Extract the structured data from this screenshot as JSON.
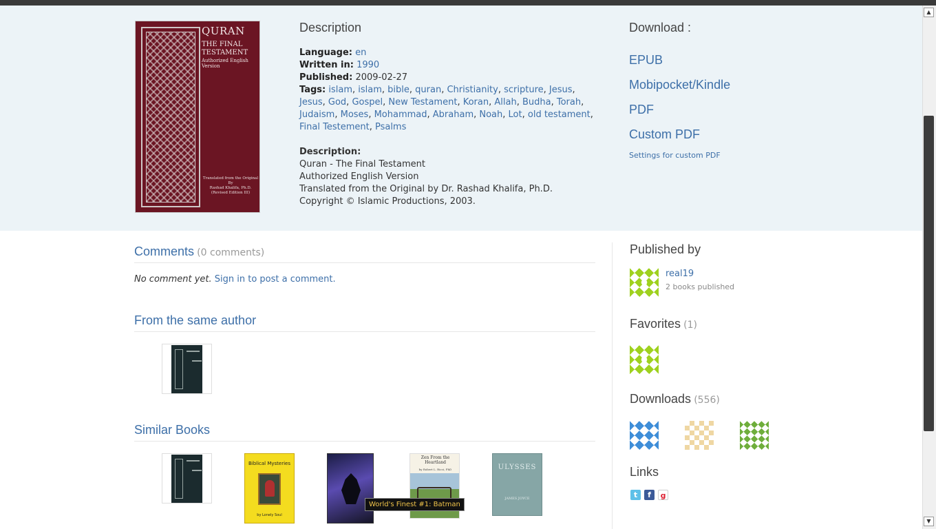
{
  "book": {
    "cover": {
      "title": "QURAN",
      "subtitle": "THE FINAL TESTAMENT",
      "edition": "Authorized English Version",
      "footer_line1": "Translated from the Original",
      "footer_line2": "By",
      "footer_line3": "Rashad Khalifa, Ph.D.",
      "footer_line4": "(Revised Edition III)"
    },
    "description_heading": "Description",
    "language_label": "Language:",
    "language_value": "en",
    "written_label": "Written in:",
    "written_value": "1990",
    "published_label": "Published:",
    "published_value": "2009-02-27",
    "tags_label": "Tags:",
    "tags": [
      "islam",
      "islam",
      "bible",
      "quran",
      "Christianity",
      "scripture",
      "Jesus",
      "Jesus",
      "God",
      "Gospel",
      "New Testament",
      "Koran",
      "Allah",
      "Budha",
      "Torah",
      "Judaism",
      "Moses",
      "Mohammad",
      "Abraham",
      "Noah",
      "Lot",
      "old testament",
      "Final Testement",
      "Psalms"
    ],
    "desc_label": "Description:",
    "desc_lines": [
      "Quran - The Final Testament",
      "Authorized English Version",
      "Translated from the Original by Dr. Rashad Khalifa, Ph.D.",
      "Copyright © Islamic Productions, 2003."
    ]
  },
  "download": {
    "heading": "Download :",
    "links": [
      "EPUB",
      "Mobipocket/Kindle",
      "PDF",
      "Custom PDF"
    ],
    "settings_link": "Settings for custom PDF"
  },
  "comments": {
    "title": "Comments",
    "count": "(0 comments)",
    "empty_text": "No comment yet.",
    "signin_link": "Sign in to post a comment."
  },
  "same_author": {
    "title": "From the same author"
  },
  "similar": {
    "title": "Similar Books",
    "books": [
      {
        "name": "similar-book-1"
      },
      {
        "name": "similar-book-2",
        "cover_title": "Biblical Mysteries",
        "cover_author": "by Lonely Soul"
      },
      {
        "name": "similar-book-3",
        "cover_title": ""
      },
      {
        "name": "similar-book-4",
        "cover_title": "Zen From the Heartland",
        "cover_author": "by Robert L. Ricci, PhD"
      },
      {
        "name": "similar-book-5",
        "cover_title": "ULYSSES",
        "cover_author": "JAMES JOYCE"
      }
    ],
    "tooltip": "World's Finest #1: Batman"
  },
  "sidebar": {
    "published_by": "Published by",
    "publisher_name": "real19",
    "publisher_books": "2 books published",
    "favorites": "Favorites",
    "favorites_count": "(1)",
    "downloads": "Downloads",
    "downloads_count": "(556)",
    "links": "Links",
    "social_icons": [
      "twitter-icon",
      "facebook-icon",
      "google-icon"
    ]
  },
  "colors": {
    "link": "#3d6fa8",
    "hero_bg": "#ecf3f7",
    "cover": "#6b1523"
  }
}
